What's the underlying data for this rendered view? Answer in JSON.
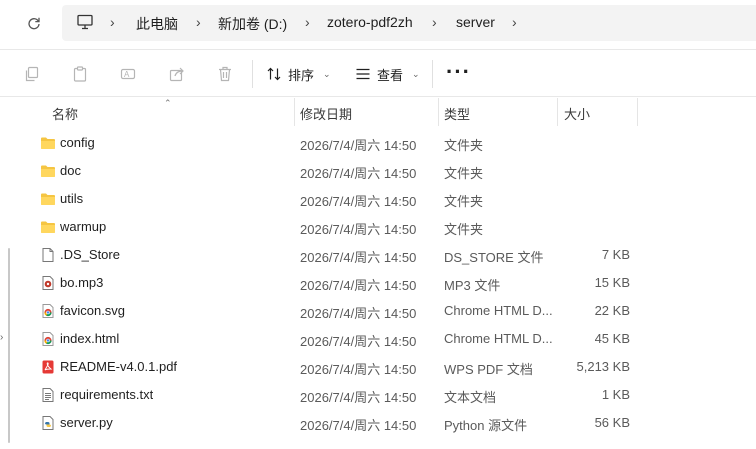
{
  "breadcrumb": {
    "items": [
      "此电脑",
      "新加卷 (D:)",
      "zotero-pdf2zh",
      "server"
    ]
  },
  "toolbar": {
    "sort_label": "排序",
    "view_label": "查看",
    "more_label": "···"
  },
  "columns": {
    "name": "名称",
    "date": "修改日期",
    "type": "类型",
    "size": "大小"
  },
  "files": [
    {
      "name": "config",
      "date": "2026/7/4/周六 14:50",
      "type": "文件夹",
      "size": "",
      "icon": "folder-icon"
    },
    {
      "name": "doc",
      "date": "2026/7/4/周六 14:50",
      "type": "文件夹",
      "size": "",
      "icon": "folder-icon"
    },
    {
      "name": "utils",
      "date": "2026/7/4/周六 14:50",
      "type": "文件夹",
      "size": "",
      "icon": "folder-icon"
    },
    {
      "name": "warmup",
      "date": "2026/7/4/周六 14:50",
      "type": "文件夹",
      "size": "",
      "icon": "folder-icon"
    },
    {
      "name": ".DS_Store",
      "date": "2026/7/4/周六 14:50",
      "type": "DS_STORE 文件",
      "size": "7 KB",
      "icon": "file-icon"
    },
    {
      "name": "bo.mp3",
      "date": "2026/7/4/周六 14:50",
      "type": "MP3 文件",
      "size": "15 KB",
      "icon": "audio-file-icon"
    },
    {
      "name": "favicon.svg",
      "date": "2026/7/4/周六 14:50",
      "type": "Chrome HTML D...",
      "size": "22 KB",
      "icon": "chrome-file-icon"
    },
    {
      "name": "index.html",
      "date": "2026/7/4/周六 14:50",
      "type": "Chrome HTML D...",
      "size": "45 KB",
      "icon": "chrome-file-icon"
    },
    {
      "name": "README-v4.0.1.pdf",
      "date": "2026/7/4/周六 14:50",
      "type": "WPS PDF 文档",
      "size": "5,213 KB",
      "icon": "pdf-file-icon"
    },
    {
      "name": "requirements.txt",
      "date": "2026/7/4/周六 14:50",
      "type": "文本文档",
      "size": "1 KB",
      "icon": "text-file-icon"
    },
    {
      "name": "server.py",
      "date": "2026/7/4/周六 14:50",
      "type": "Python 源文件",
      "size": "56 KB",
      "icon": "python-file-icon"
    }
  ]
}
